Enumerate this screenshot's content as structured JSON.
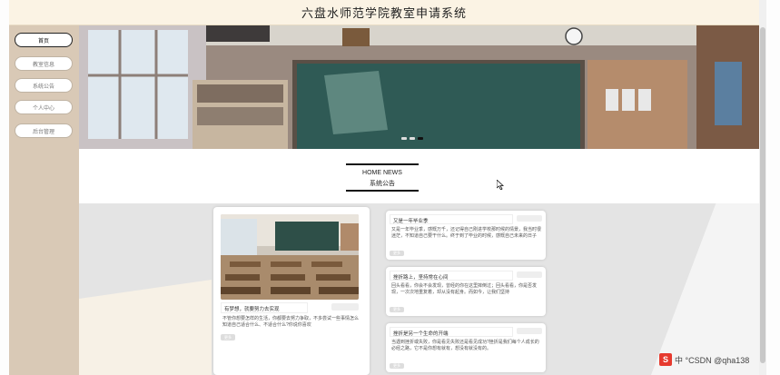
{
  "app": {
    "title": "六盘水师范学院教室申请系统"
  },
  "sidebar": {
    "items": [
      {
        "label": "首页",
        "active": true
      },
      {
        "label": "教室信息",
        "active": false
      },
      {
        "label": "系统公告",
        "active": false
      },
      {
        "label": "个人中心",
        "active": false
      },
      {
        "label": "后台管理",
        "active": false
      }
    ]
  },
  "banner": {
    "slides": 3,
    "active_slide": 2
  },
  "news": {
    "heading_en": "HOME NEWS",
    "heading_cn": "系统公告",
    "featured": {
      "title": "有梦想，就要努力去实现",
      "description": "不管你想要怎样的生活，你都要去努力争取，不多尝试一些事情怎么知道自己适合什么、不适合什么?你说你喜欢",
      "date": "",
      "more": "更多"
    },
    "items": [
      {
        "title": "又是一年毕业季",
        "description": "又是一年毕业季，感慨万千，还记得自己刚进学校那时候的情景，我当时很迷茫，不知道自己要干什么。终于到了毕业的时候，感慨自己未来的日子",
        "date": "",
        "more": "更多"
      },
      {
        "title": "挫折路上，坚持常在心间",
        "description": "回头看看，你会不会发现，曾经的你在这里摔倒过；回头看看，你是否发现，一次次地重复着，却从没有起身。而如今，让我们坚持",
        "date": "",
        "more": "更多"
      },
      {
        "title": "挫折是另一个生命的开端",
        "description": "当遇到挫折或失败，你是看见失败还是看见成功?挫折是我们每个人成长的必经之路，它不是你想有就有，想没有就没有的。",
        "date": "",
        "more": "更多"
      }
    ]
  },
  "watermark": {
    "text": "中 °CSDN @qha138"
  },
  "colors": {
    "titlebar_bg": "#fbf3e4",
    "sidebar_bg": "#d9c9b6",
    "news_bg": "#e4e4e4"
  }
}
